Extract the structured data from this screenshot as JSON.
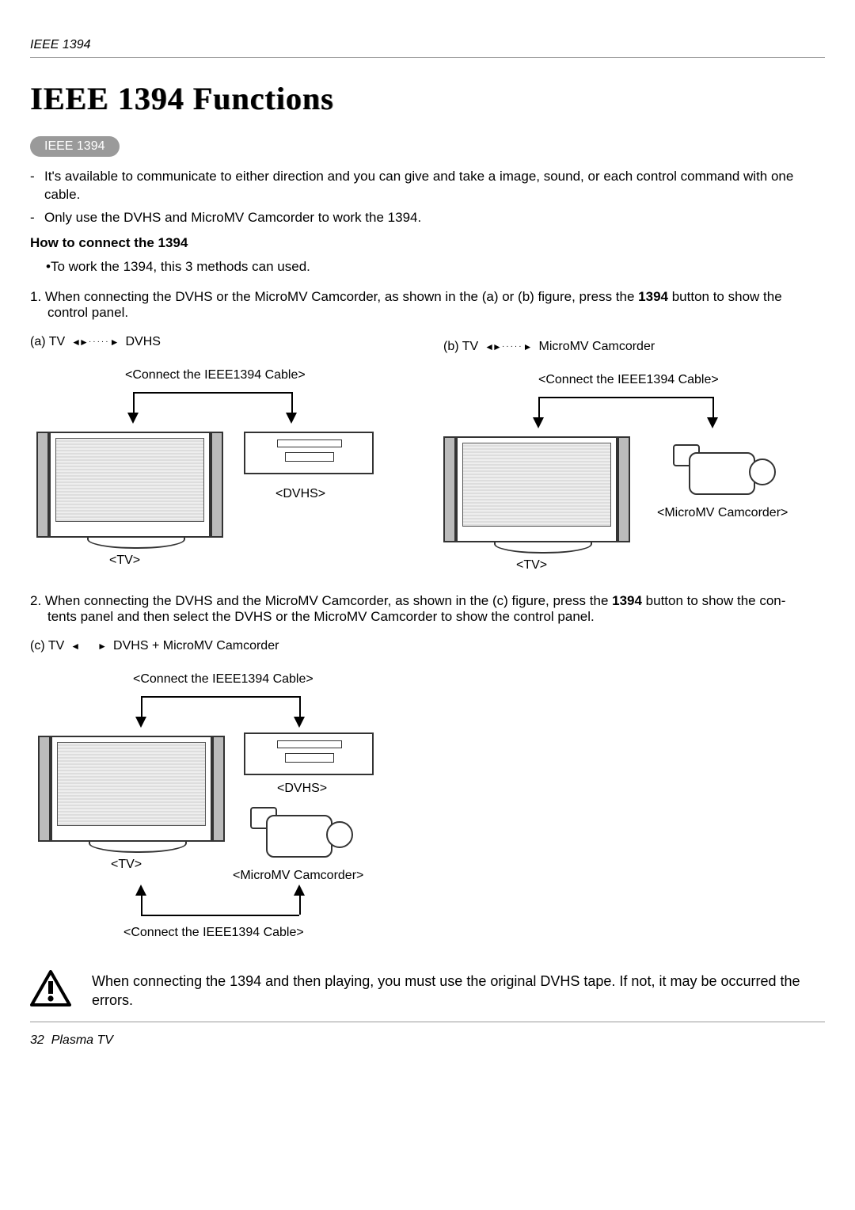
{
  "header": {
    "section": "IEEE 1394"
  },
  "title": "IEEE 1394 Functions",
  "pill": "IEEE 1394",
  "intro": {
    "b1": "It's available to communicate to either direction and you can give and take a image, sound, or each control command with one cable.",
    "b2": "Only use the DVHS and MicroMV Camcorder to work the 1394."
  },
  "howto_head": "How to connect the 1394",
  "howto_bullet": "•To work the 1394, this  3 methods can used.",
  "step1": {
    "pre": "1. When connecting  the DVHS or the MicroMV Camcorder, as shown in the (a) or (b) figure, press the ",
    "bold": "1394",
    "post": " button to show the",
    "line2": "control panel."
  },
  "labels": {
    "a_tv": "(a) TV",
    "a_dev": "DVHS",
    "b_tv": "(b) TV",
    "b_dev": "MicroMV Camcorder",
    "c_tv": "(c) TV",
    "c_dev": "DVHS + MicroMV Camcorder",
    "connect": "<Connect the IEEE1394 Cable>",
    "tv": "<TV>",
    "dvhs": "<DVHS>",
    "cam": "<MicroMV Camcorder>"
  },
  "step2": {
    "pre": "2. When connecting  the DVHS and the MicroMV Camcorder, as shown in the (c) figure, press the ",
    "bold": "1394",
    "post": " button to show the con-",
    "line2": "tents panel and then select the DVHS or the MicroMV Camcorder to show the control panel."
  },
  "warning": "When connecting the 1394 and then playing, you must use the original DVHS tape. If not, it may be occurred the errors.",
  "footer": {
    "page": "32",
    "product": "Plasma TV"
  }
}
